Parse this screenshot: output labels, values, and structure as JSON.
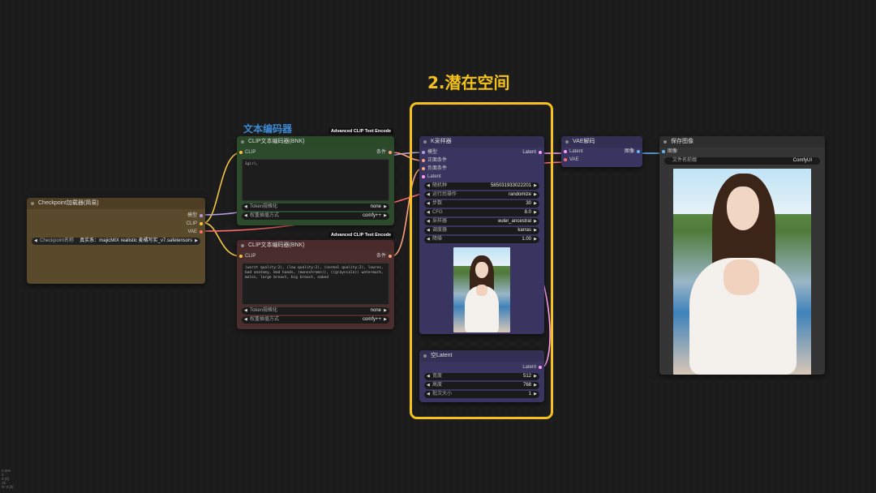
{
  "annotations": {
    "latent_space_title": "2.潜在空间",
    "text_encoder_title": "文本编码器",
    "highlight_color": "#f4c21b",
    "text_encoder_color": "#3d8bd6"
  },
  "checkpoint_node": {
    "title": "Checkpoint加载器(简易)",
    "outputs": [
      "模型",
      "CLIP",
      "VAE"
    ],
    "widget_label": "Checkpoint名称",
    "widget_value": "真实系：majicMIX realistic 麦橘写实_v7.safetensors"
  },
  "clip_pos_node": {
    "badge": "Advanced CLIP Text Encode",
    "title": "CLIP文本编码器(BNK)",
    "input": "CLIP",
    "output": "条件",
    "text": "1girl,",
    "widgets": [
      {
        "label": "Token规格化",
        "value": "none"
      },
      {
        "label": "权重插值方式",
        "value": "comfy++"
      }
    ]
  },
  "clip_neg_node": {
    "badge": "Advanced CLIP Text Encode",
    "title": "CLIP文本编码器(BNK)",
    "input": "CLIP",
    "output": "条件",
    "text": "(worst quality:2), (low quality:2), (normal quality:2), lowres, bad anatomy, bad hands, (monochrome)), ((grayscale)) watermark, moles, large breast, big breast, naked",
    "widgets": [
      {
        "label": "Token规格化",
        "value": "none"
      },
      {
        "label": "权重插值方式",
        "value": "comfy++"
      }
    ]
  },
  "ksampler_node": {
    "title": "K采样器",
    "inputs": [
      "模型",
      "正面条件",
      "负面条件",
      "Latent"
    ],
    "output": "Latent",
    "widgets": [
      {
        "label": "随机种",
        "value": "585031933022201"
      },
      {
        "label": "运行后操作",
        "value": "randomize"
      },
      {
        "label": "步数",
        "value": "30"
      },
      {
        "label": "CFG",
        "value": "8.0"
      },
      {
        "label": "采样器",
        "value": "euler_ancestral"
      },
      {
        "label": "调度器",
        "value": "karras"
      },
      {
        "label": "降噪",
        "value": "1.00"
      }
    ]
  },
  "empty_latent_node": {
    "title": "空Latent",
    "output": "Latent",
    "widgets": [
      {
        "label": "宽度",
        "value": "512"
      },
      {
        "label": "高度",
        "value": "768"
      },
      {
        "label": "批次大小",
        "value": "1"
      }
    ]
  },
  "vae_node": {
    "title": "VAE解码",
    "inputs": [
      "Latent",
      "VAE"
    ],
    "output": "图像"
  },
  "save_node": {
    "title": "保存图像",
    "input": "图像",
    "widget_label": "文件名前缀",
    "widget_value": "ComfyUI"
  },
  "stats": {
    "line1": "0.00s",
    "line2": "0",
    "line3": "0 [0]",
    "line4": "15",
    "line5": "N: 0 [0]"
  },
  "colors": {
    "clip_link": "#f5c542",
    "model_link": "#b39ddb",
    "cond_link": "#ffa07a",
    "latent_link": "#ff9cf9",
    "vae_link": "#ff6e6e",
    "image_link": "#64b5f6"
  }
}
